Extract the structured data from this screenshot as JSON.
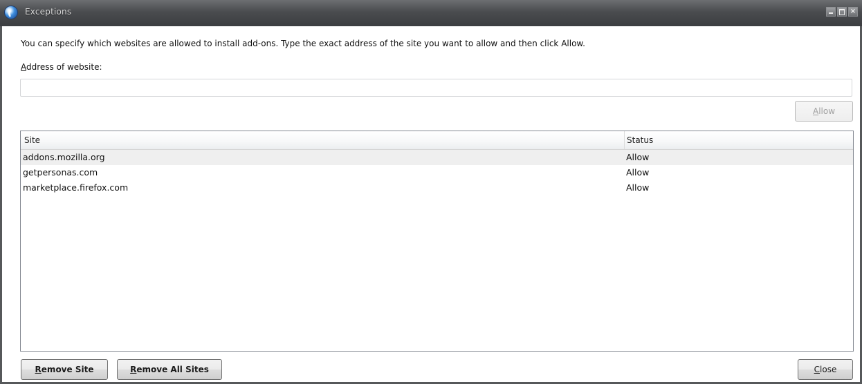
{
  "window": {
    "title": "Exceptions",
    "controls": [
      "minimize",
      "maximize",
      "close"
    ]
  },
  "dialog": {
    "description": "You can specify which websites are allowed to install add-ons. Type the exact address of the site you want to allow and then click Allow.",
    "address_label_key": "A",
    "address_label_rest": "ddress of website:",
    "address_value": "",
    "address_placeholder": "",
    "allow_key": "A",
    "allow_rest": "llow"
  },
  "table": {
    "columns": [
      "Site",
      "Status"
    ],
    "rows": [
      {
        "site": "addons.mozilla.org",
        "status": "Allow"
      },
      {
        "site": "getpersonas.com",
        "status": "Allow"
      },
      {
        "site": "marketplace.firefox.com",
        "status": "Allow"
      }
    ]
  },
  "buttons": {
    "remove_site_key": "R",
    "remove_site_rest": "emove Site",
    "remove_all_key": "R",
    "remove_all_rest": "emove All Sites",
    "close_key": "C",
    "close_rest": "lose"
  },
  "colors": {
    "titlebar": "#4a4c4f",
    "selected_row": "#efefef",
    "disabled_text": "#a0a0a0"
  }
}
